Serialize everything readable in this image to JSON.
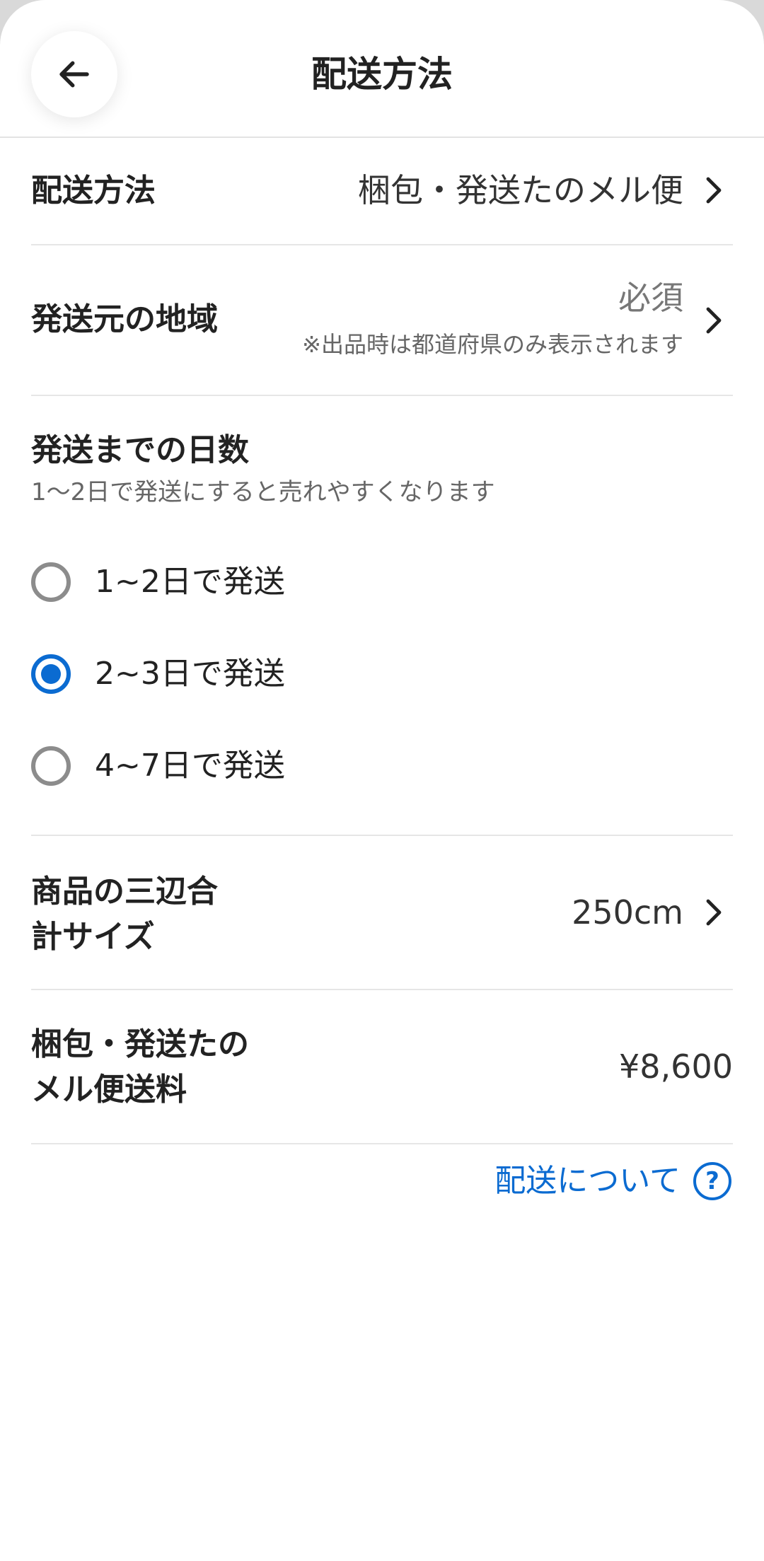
{
  "header": {
    "title": "配送方法",
    "back_icon": "arrow-left-icon"
  },
  "shipping_method": {
    "label": "配送方法",
    "value": "梱包・発送たのメル便"
  },
  "origin_region": {
    "label": "発送元の地域",
    "value": "必須",
    "note": "※出品時は都道府県のみ表示されます"
  },
  "days_to_ship": {
    "label": "発送までの日数",
    "hint": "1〜2日で発送にすると売れやすくなります",
    "options": [
      {
        "label": "1~2日で発送",
        "selected": false
      },
      {
        "label": "2~3日で発送",
        "selected": true
      },
      {
        "label": "4~7日で発送",
        "selected": false
      }
    ]
  },
  "size": {
    "label_line1": "商品の三辺合",
    "label_line2": "計サイズ",
    "value": "250cm"
  },
  "fee": {
    "label_line1": "梱包・発送たの",
    "label_line2": "メル便送料",
    "value": "¥8,600"
  },
  "help": {
    "label": "配送について",
    "icon_text": "?"
  },
  "colors": {
    "accent": "#0b6bd1",
    "divider": "#e6e6e6"
  }
}
